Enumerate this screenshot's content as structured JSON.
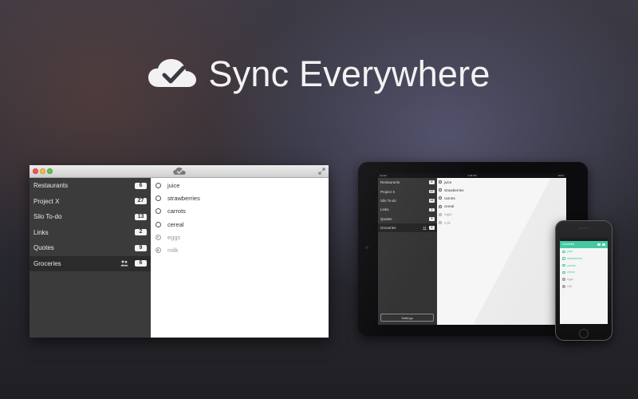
{
  "headline": {
    "text": "Sync Everywhere",
    "logo_icon": "cloud-check-icon"
  },
  "colors": {
    "accent_teal": "#46c8a4",
    "sidebar_dark": "#3b3b3b",
    "background": "#2a2a32"
  },
  "mac_app": {
    "title_icon": "cloud-check-icon",
    "sidebar": [
      {
        "label": "Restaurants",
        "count": "6"
      },
      {
        "label": "Project X",
        "count": "27"
      },
      {
        "label": "Silo To-do",
        "count": "13"
      },
      {
        "label": "Links",
        "count": "2"
      },
      {
        "label": "Quotes",
        "count": "9"
      },
      {
        "label": "Groceries",
        "count": "6",
        "shared": true,
        "selected": true
      }
    ],
    "tasks": [
      {
        "text": "juice",
        "done": false
      },
      {
        "text": "strawberries",
        "done": false
      },
      {
        "text": "carrots",
        "done": false
      },
      {
        "text": "cereal",
        "done": false
      },
      {
        "text": "eggs",
        "done": true
      },
      {
        "text": "milk",
        "done": true
      }
    ]
  },
  "ipad_app": {
    "status": {
      "carrier": "Carrier",
      "time": "3:38 PM",
      "battery": "100%"
    },
    "sidebar": [
      {
        "label": "Restaurants",
        "count": "6"
      },
      {
        "label": "Project X",
        "count": "27"
      },
      {
        "label": "Silo To-do",
        "count": "13"
      },
      {
        "label": "Links",
        "count": "2"
      },
      {
        "label": "Quotes",
        "count": "9"
      },
      {
        "label": "Groceries",
        "count": "6",
        "selected": true
      }
    ],
    "settings_label": "Settings",
    "tasks": [
      {
        "text": "juice",
        "done": false
      },
      {
        "text": "strawberries",
        "done": false
      },
      {
        "text": "carrots",
        "done": false
      },
      {
        "text": "cereal",
        "done": false
      },
      {
        "text": "eggs",
        "done": true
      },
      {
        "text": "milk",
        "done": true
      }
    ]
  },
  "iphone_app": {
    "nav_title": "Groceries",
    "tasks": [
      {
        "text": "juice",
        "done": false
      },
      {
        "text": "strawberries",
        "done": false
      },
      {
        "text": "carrots",
        "done": false
      },
      {
        "text": "cereal",
        "done": false
      },
      {
        "text": "eggs",
        "done": true
      },
      {
        "text": "milk",
        "done": true
      }
    ]
  }
}
